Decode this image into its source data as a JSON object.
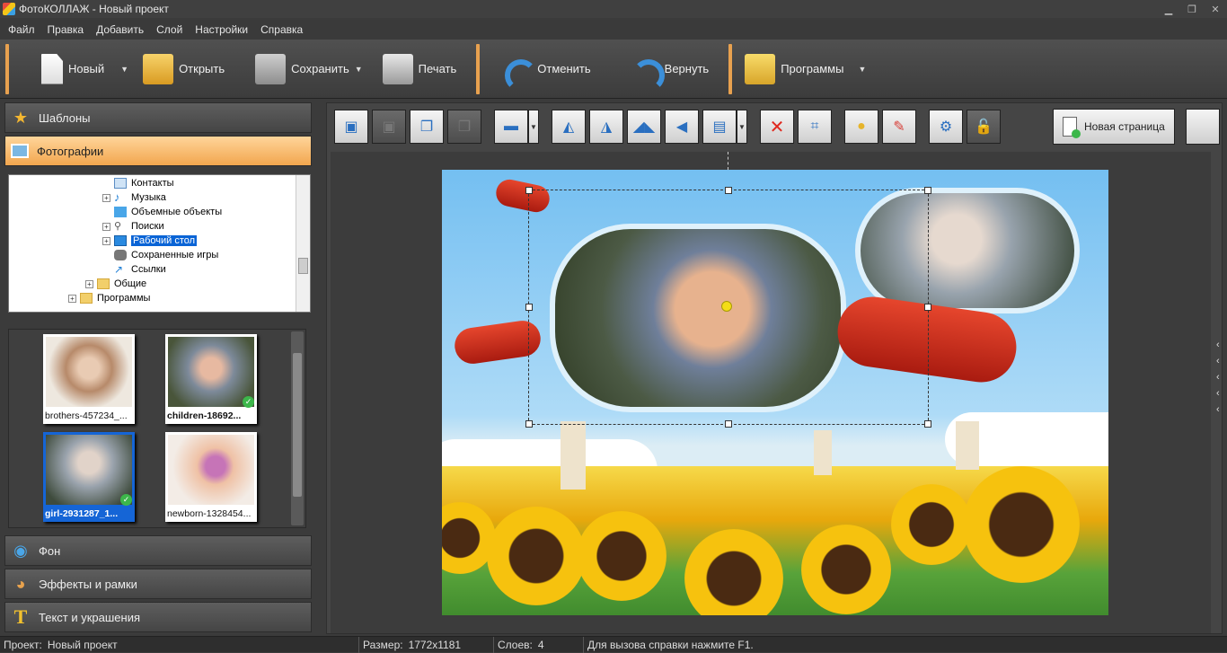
{
  "window": {
    "title": "ФотоКОЛЛАЖ - Новый проект",
    "minimize": "▁",
    "restore": "❐",
    "close": "✕"
  },
  "menu": [
    "Файл",
    "Правка",
    "Добавить",
    "Слой",
    "Настройки",
    "Справка"
  ],
  "toolbar": {
    "new_label": "Новый",
    "open_label": "Открыть",
    "save_label": "Сохранить",
    "print_label": "Печать",
    "undo_label": "Отменить",
    "redo_label": "Вернуть",
    "programs_label": "Программы",
    "dropdown_glyph": "▼"
  },
  "left_panel": {
    "templates_label": "Шаблоны",
    "photos_label": "Фотографии",
    "background_label": "Фон",
    "effects_label": "Эффекты и рамки",
    "text_label": "Текст и украшения"
  },
  "tree": {
    "items": [
      {
        "label": "Контакты",
        "expander": "",
        "icon": "contacts-icon"
      },
      {
        "label": "Музыка",
        "expander": "+",
        "icon": "music-icon"
      },
      {
        "label": "Объемные объекты",
        "expander": "",
        "icon": "3d-objects-icon"
      },
      {
        "label": "Поиски",
        "expander": "+",
        "icon": "search-icon"
      },
      {
        "label": "Рабочий стол",
        "expander": "+",
        "icon": "desktop-icon",
        "selected": true
      },
      {
        "label": "Сохраненные игры",
        "expander": "",
        "icon": "saved-games-icon"
      },
      {
        "label": "Ссылки",
        "expander": "",
        "icon": "links-icon"
      },
      {
        "label": "Общие",
        "expander": "+",
        "icon": "folder-icon"
      },
      {
        "label": "Программы",
        "expander": "+",
        "icon": "folder-icon"
      }
    ]
  },
  "thumbnails": [
    {
      "caption": "brothers-457234_...",
      "checked": false,
      "selected": false
    },
    {
      "caption": "children-18692...",
      "checked": true,
      "selected": false
    },
    {
      "caption": "girl-2931287_1...",
      "checked": true,
      "selected": true
    },
    {
      "caption": "newborn-1328454...",
      "checked": false,
      "selected": false
    }
  ],
  "edit_toolbar": {
    "new_page_label": "Новая страница"
  },
  "status": {
    "project_label": "Проект:",
    "project_value": "Новый проект",
    "size_label": "Размер:",
    "size_value": "1772x1181",
    "layers_label": "Слоев:",
    "layers_value": "4",
    "help_text": "Для вызова справки нажмите F1."
  },
  "colors": {
    "accent": "#f2a64e",
    "selection": "#0a64d6",
    "check": "#3cb74a"
  }
}
